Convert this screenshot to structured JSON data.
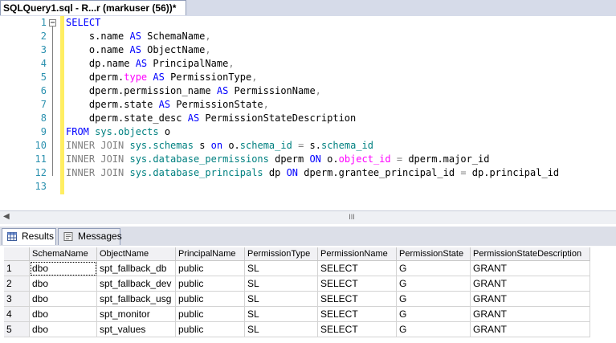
{
  "tabs": {
    "active_label": "SQLQuery1.sql - R...r (markuser (56))*"
  },
  "editor": {
    "line_numbers": [
      "1",
      "2",
      "3",
      "4",
      "5",
      "6",
      "7",
      "8",
      "9",
      "10",
      "11",
      "12",
      "13"
    ]
  },
  "scrollbar": {
    "left_arrow": "◀",
    "thumb_grip": "III"
  },
  "results_tabs": [
    {
      "label": "Results",
      "icon": "grid-icon",
      "active": true
    },
    {
      "label": "Messages",
      "icon": "messages-icon",
      "active": false
    }
  ],
  "grid": {
    "columns": [
      "SchemaName",
      "ObjectName",
      "PrincipalName",
      "PermissionType",
      "PermissionName",
      "PermissionState",
      "PermissionStateDescription"
    ],
    "rows": [
      {
        "n": "1",
        "cells": [
          "dbo",
          "spt_fallback_db",
          "public",
          "SL",
          "SELECT",
          "G",
          "GRANT"
        ]
      },
      {
        "n": "2",
        "cells": [
          "dbo",
          "spt_fallback_dev",
          "public",
          "SL",
          "SELECT",
          "G",
          "GRANT"
        ]
      },
      {
        "n": "3",
        "cells": [
          "dbo",
          "spt_fallback_usg",
          "public",
          "SL",
          "SELECT",
          "G",
          "GRANT"
        ]
      },
      {
        "n": "4",
        "cells": [
          "dbo",
          "spt_monitor",
          "public",
          "SL",
          "SELECT",
          "G",
          "GRANT"
        ]
      },
      {
        "n": "5",
        "cells": [
          "dbo",
          "spt_values",
          "public",
          "SL",
          "SELECT",
          "G",
          "GRANT"
        ]
      }
    ]
  },
  "colors": {
    "keyword": "#0000ff",
    "gray": "#808080",
    "function": "#008080",
    "system": "#ff00ff",
    "line_number": "#2b91af",
    "change_bar": "#ffee62"
  }
}
